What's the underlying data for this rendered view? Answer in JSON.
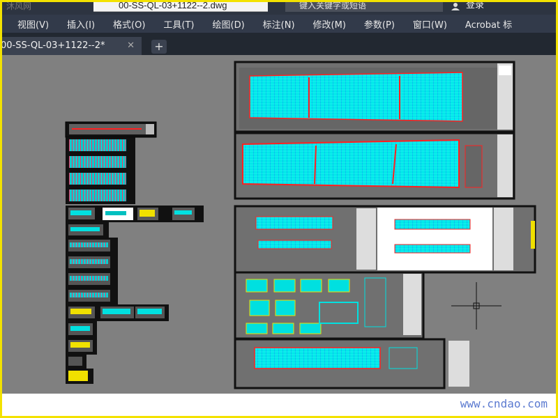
{
  "title_bar": {
    "app_logo_text": "沐风网",
    "file_title": "00-SS-QL-03+1122--2.dwg",
    "search_placeholder": "键入关键字或短语",
    "sign_in_label": "登录"
  },
  "menu": {
    "items": [
      "视图(V)",
      "插入(I)",
      "格式(O)",
      "工具(T)",
      "绘图(D)",
      "标注(N)",
      "修改(M)",
      "参数(P)",
      "窗口(W)",
      "Acrobat 标"
    ]
  },
  "tabs": {
    "active_label": "00-SS-QL-03+1122--2*",
    "close_glyph": "✕",
    "add_glyph": "+"
  },
  "watermark": {
    "text": "www.cndao.com"
  },
  "colors": {
    "canvas_bg": "#808080",
    "drawing_cyan": "#00ffff",
    "drawing_red": "#ff2020",
    "drawing_magenta": "#ff00ff",
    "drawing_yellow": "#ffff00",
    "sheet_border": "#000000",
    "outer_frame": "#f3e200"
  }
}
